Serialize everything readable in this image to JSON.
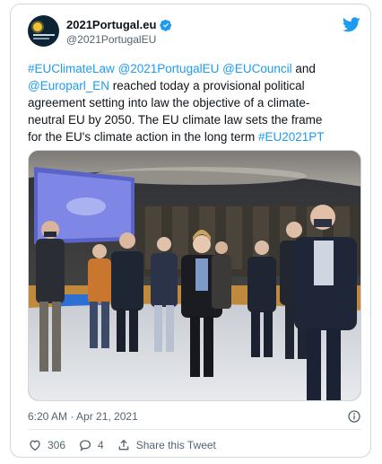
{
  "account": {
    "name": "2021Portugal.eu",
    "handle": "@2021PortugalEU",
    "avatar_icon": "eu-presidency-sun-logo",
    "verified": true
  },
  "tweet": {
    "lines": [
      [
        {
          "t": "#EUClimateLaw",
          "link": true
        },
        {
          "t": " ",
          "link": false
        },
        {
          "t": "@2021PortugalEU",
          "link": true
        },
        {
          "t": " ",
          "link": false
        },
        {
          "t": "@EUCouncil",
          "link": true
        },
        {
          "t": " and",
          "link": false
        }
      ],
      [
        {
          "t": "@Europarl_EN",
          "link": true
        },
        {
          "t": " reached today a provisional political",
          "link": false
        }
      ],
      [
        {
          "t": "agreement setting into law the objective of a climate-",
          "link": false
        }
      ],
      [
        {
          "t": "neutral EU by 2050. The EU climate law sets the frame",
          "link": false
        }
      ],
      [
        {
          "t": "for the EU's climate action in the long term ",
          "link": false
        },
        {
          "t": "#EU2021PT",
          "link": true
        }
      ]
    ]
  },
  "timestamp": "6:20 AM · Apr 21, 2021",
  "actions": {
    "likes": "306",
    "replies": "4",
    "share_label": "Share this Tweet"
  },
  "colors": {
    "link": "#1d9bf0",
    "muted": "#536471",
    "border": "#cfd9de",
    "twitter_blue": "#1d9bf0"
  },
  "icons": [
    "twitter-bird-icon",
    "verified-badge-icon",
    "info-icon",
    "heart-icon",
    "reply-icon",
    "share-icon"
  ]
}
